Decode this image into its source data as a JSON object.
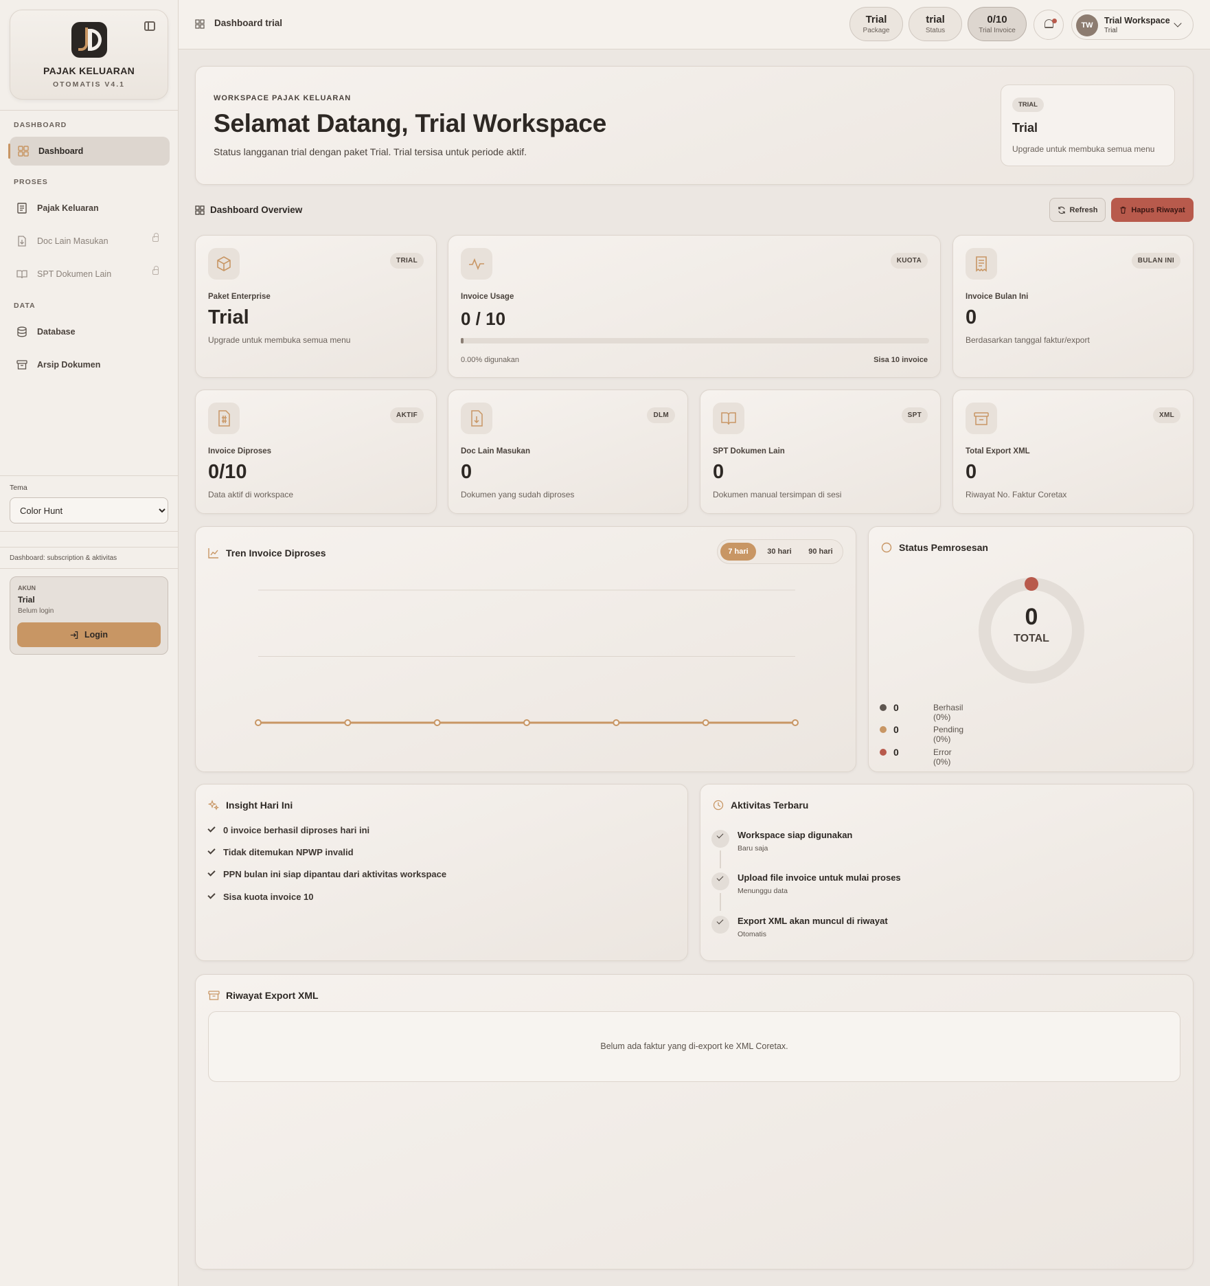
{
  "app": {
    "brand_title": "PAJAK KELUARAN",
    "brand_sub": "OTOMATIS V4.1"
  },
  "sidebar": {
    "sections": [
      "DASHBOARD",
      "PROSES",
      "DATA"
    ],
    "items": [
      {
        "label": "Dashboard",
        "icon": "dashboard-icon",
        "active": true
      },
      {
        "label": "Pajak Keluaran",
        "icon": "receipt-icon"
      },
      {
        "label": "Doc Lain Masukan",
        "icon": "file-download-icon",
        "locked": true
      },
      {
        "label": "SPT Dokumen Lain",
        "icon": "book-icon",
        "locked": true
      },
      {
        "label": "Database",
        "icon": "database-icon"
      },
      {
        "label": "Arsip Dokumen",
        "icon": "archive-icon"
      }
    ],
    "theme_label": "Tema",
    "theme_value": "Color Hunt",
    "hint": "Dashboard: subscription & aktivitas",
    "account": {
      "label": "AKUN",
      "name": "Trial",
      "status": "Belum login",
      "login_label": "Login"
    }
  },
  "topbar": {
    "title": "Dashboard trial",
    "pills": [
      {
        "value": "Trial",
        "label": "Package"
      },
      {
        "value": "trial",
        "label": "Status"
      },
      {
        "value": "0/10",
        "label": "Trial Invoice"
      }
    ],
    "user": {
      "initials": "TW",
      "name": "Trial Workspace",
      "sub": "Trial"
    }
  },
  "hero": {
    "eyebrow": "WORKSPACE PAJAK KELUARAN",
    "title": "Selamat Datang, Trial Workspace",
    "description": "Status langganan trial dengan paket Trial. Trial tersisa untuk periode aktif.",
    "side": {
      "tag": "TRIAL",
      "name": "Trial",
      "desc": "Upgrade untuk membuka semua menu"
    }
  },
  "overview": {
    "title": "Dashboard Overview",
    "refresh_label": "Refresh",
    "delete_label": "Hapus Riwayat"
  },
  "stats": {
    "paket": {
      "badge": "TRIAL",
      "label": "Paket Enterprise",
      "value": "Trial",
      "desc": "Upgrade untuk membuka semua menu"
    },
    "usage": {
      "badge": "KUOTA",
      "label": "Invoice Usage",
      "value": "0 / 10",
      "progress_fraction": 0,
      "used_text": "0.00% digunakan",
      "remaining_text": "Sisa 10 invoice"
    },
    "bulan": {
      "badge": "BULAN INI",
      "label": "Invoice Bulan Ini",
      "value": "0",
      "desc": "Berdasarkan tanggal faktur/export"
    },
    "diproses": {
      "badge": "AKTIF",
      "label": "Invoice Diproses",
      "value": "0/10",
      "desc": "Data aktif di workspace"
    },
    "doc": {
      "badge": "DLM",
      "label": "Doc Lain Masukan",
      "value": "0",
      "desc": "Dokumen yang sudah diproses"
    },
    "spt": {
      "badge": "SPT",
      "label": "SPT Dokumen Lain",
      "value": "0",
      "desc": "Dokumen manual tersimpan di sesi"
    },
    "xml": {
      "badge": "XML",
      "label": "Total Export XML",
      "value": "0",
      "desc": "Riwayat No. Faktur Coretax"
    }
  },
  "trend": {
    "title": "Tren Invoice Diproses",
    "ranges": [
      "7 hari",
      "30 hari",
      "90 hari"
    ],
    "active_range": "7 hari"
  },
  "chart_data": {
    "type": "line",
    "x": [
      1,
      2,
      3,
      4,
      5,
      6,
      7
    ],
    "values": [
      0,
      0,
      0,
      0,
      0,
      0,
      0
    ],
    "ylim": [
      0,
      2
    ],
    "grid": true,
    "line_color": "#c89664"
  },
  "status": {
    "title": "Status Pemrosesan",
    "total_value": "0",
    "total_label": "TOTAL",
    "legend": [
      {
        "value": "0",
        "label": "Berhasil (0%)",
        "color": "#5e5650"
      },
      {
        "value": "0",
        "label": "Pending (0%)",
        "color": "#c89664"
      },
      {
        "value": "0",
        "label": "Error (0%)",
        "color": "#b85a4c"
      }
    ]
  },
  "insight": {
    "title": "Insight Hari Ini",
    "items": [
      "0 invoice berhasil diproses hari ini",
      "Tidak ditemukan NPWP invalid",
      "PPN bulan ini siap dipantau dari aktivitas workspace",
      "Sisa kuota invoice 10"
    ]
  },
  "activity": {
    "title": "Aktivitas Terbaru",
    "items": [
      {
        "title": "Workspace siap digunakan",
        "sub": "Baru saja"
      },
      {
        "title": "Upload file invoice untuk mulai proses",
        "sub": "Menunggu data"
      },
      {
        "title": "Export XML akan muncul di riwayat",
        "sub": "Otomatis"
      }
    ]
  },
  "history": {
    "title": "Riwayat Export XML",
    "empty": "Belum ada faktur yang di-export ke XML Coretax."
  },
  "colors": {
    "accent": "#c89664",
    "danger": "#b85a4c",
    "background": "#ece7e2"
  }
}
